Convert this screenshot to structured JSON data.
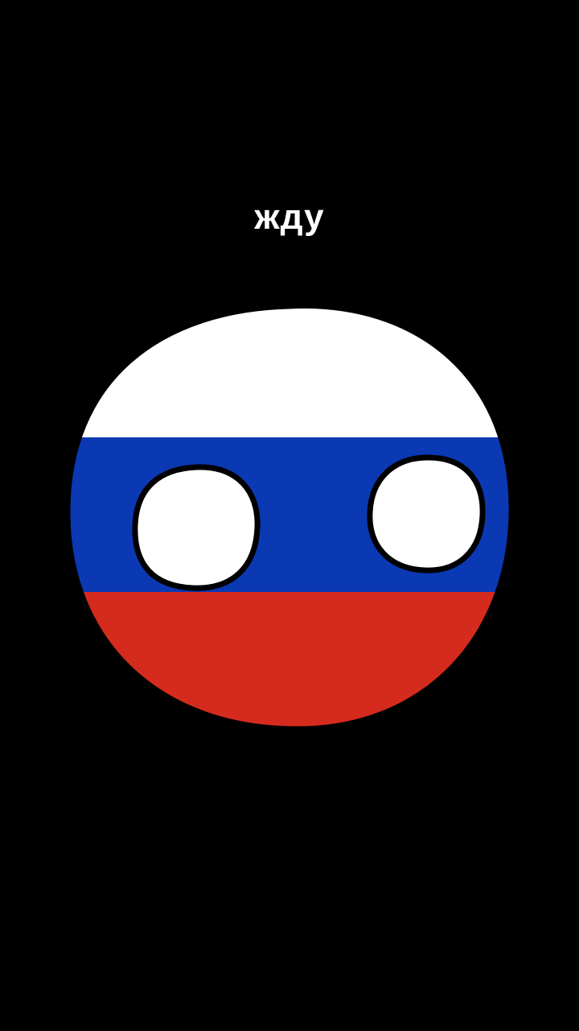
{
  "caption": "жду",
  "character": {
    "name_icon": "russia-countryball-icon",
    "colors": {
      "top": "#ffffff",
      "middle": "#0b39b4",
      "bottom": "#d52b1e",
      "outline": "#000000",
      "eyes": "#ffffff"
    }
  },
  "background_color": "#000000"
}
